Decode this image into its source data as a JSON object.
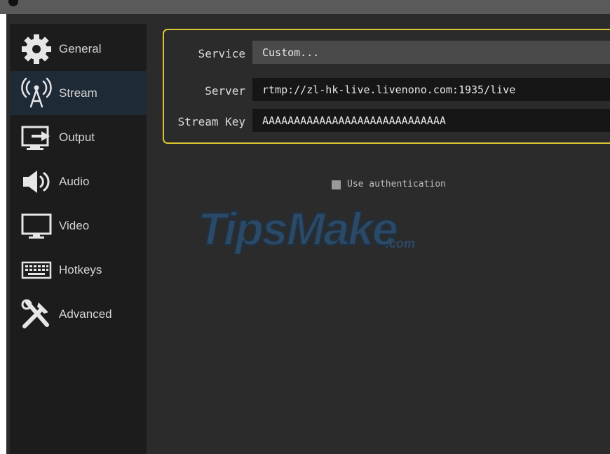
{
  "sidebar": {
    "items": [
      {
        "label": "General",
        "icon": "gear-icon"
      },
      {
        "label": "Stream",
        "icon": "antenna-icon"
      },
      {
        "label": "Output",
        "icon": "output-icon"
      },
      {
        "label": "Audio",
        "icon": "speaker-icon"
      },
      {
        "label": "Video",
        "icon": "monitor-icon"
      },
      {
        "label": "Hotkeys",
        "icon": "keyboard-icon"
      },
      {
        "label": "Advanced",
        "icon": "tools-icon"
      }
    ],
    "active": "Stream"
  },
  "stream": {
    "service_label": "Service",
    "service_value": "Custom...",
    "server_label": "Server",
    "server_value": "rtmp://zl-hk-live.livenono.com:1935/live",
    "stream_key_label": "Stream Key",
    "stream_key_value": "AAAAAAAAAAAAAAAAAAAAAAAAAAAAA",
    "use_auth_label": "Use authentication"
  },
  "watermark": {
    "main": "TipsMake",
    "suffix": ".com"
  },
  "colors": {
    "accent_border": "#d9c532",
    "active_nav_bg": "#1f2a37",
    "watermark": "#2c4a66"
  }
}
